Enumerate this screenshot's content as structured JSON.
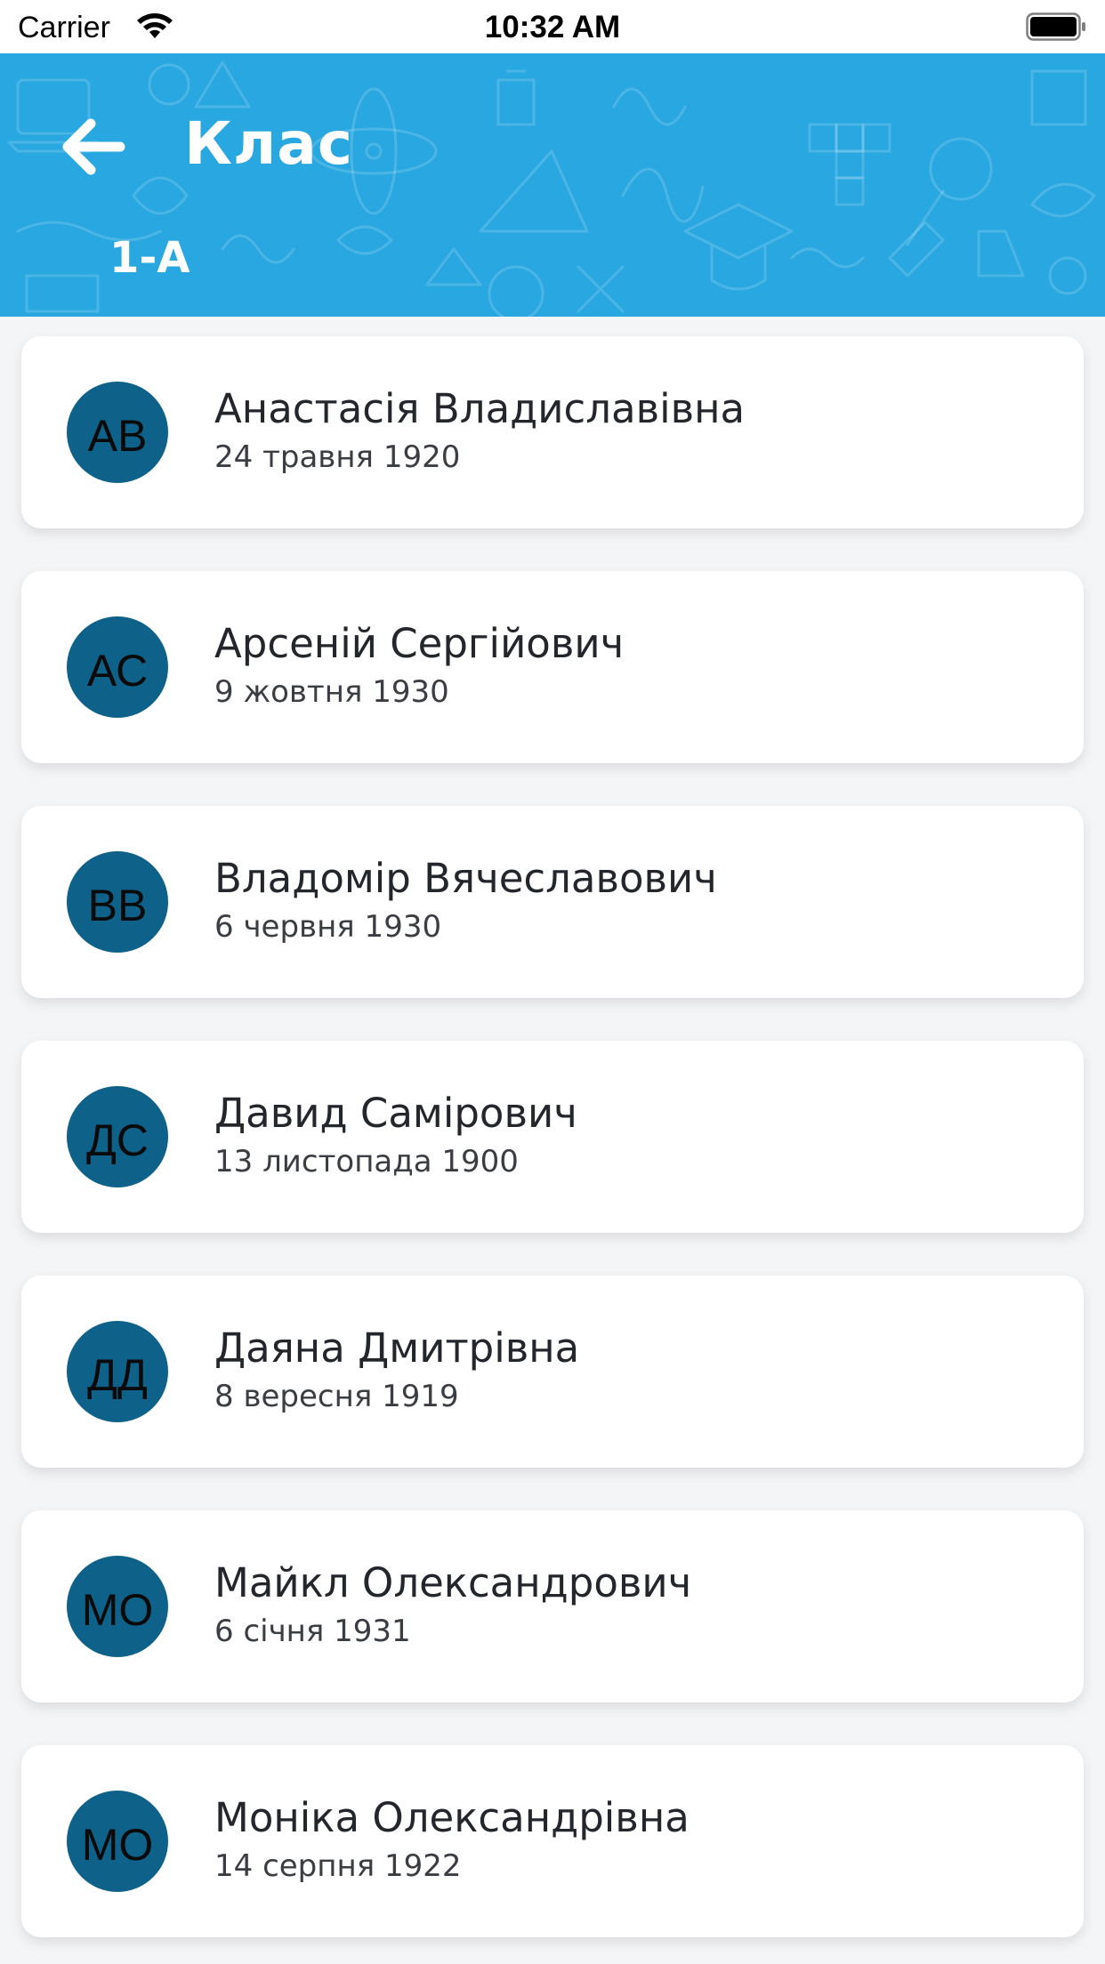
{
  "status_bar": {
    "carrier": "Carrier",
    "time": "10:32 AM"
  },
  "header": {
    "title": "Клас",
    "subtitle": "1-А",
    "background_color": "#29a7e0"
  },
  "colors": {
    "avatar": "#0e6188",
    "card": "#ffffff",
    "page": "#f4f5f7"
  },
  "students": [
    {
      "initials": "АВ",
      "name": "Анастасія Владиславівна",
      "date": "24 травня 1920"
    },
    {
      "initials": "АС",
      "name": "Арсеній Сергійович",
      "date": "9 жовтня 1930"
    },
    {
      "initials": "ВВ",
      "name": "Владомір Вячеславович",
      "date": "6 червня 1930"
    },
    {
      "initials": "ДС",
      "name": "Давид Самірович",
      "date": "13 листопада 1900"
    },
    {
      "initials": "ДД",
      "name": "Даяна Дмитрівна",
      "date": "8 вересня 1919"
    },
    {
      "initials": "МО",
      "name": "Майкл Олександрович",
      "date": "6 січня 1931"
    },
    {
      "initials": "МО",
      "name": "Моніка Олександрівна",
      "date": "14 серпня 1922"
    }
  ]
}
